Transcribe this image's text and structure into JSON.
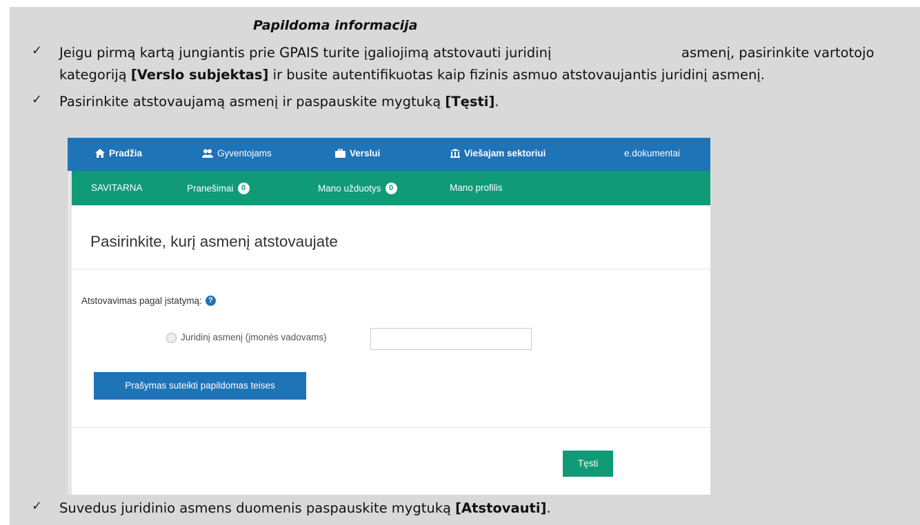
{
  "document": {
    "heading": "Papildoma informacija",
    "check_glyph": "✓",
    "bullet1": {
      "line1": "Jeigu pirmą kartą jungiantis prie GPAIS turite įgaliojimą atstovauti juridinį",
      "line1b": "asmenį, pasirinkite vartotojo",
      "line2_pre": "kategoriją ",
      "line2_bold": "[Verslo subjektas]",
      "line2_post": " ir busite autentifikuotas kaip fizinis asmuo atstovaujantis juridinį asmenį."
    },
    "bullet2": {
      "pre": "Pasirinkite atstovaujamą asmenį ir paspauskite mygtuką ",
      "bold": "[Tęsti]",
      "post": "."
    },
    "bullet3": {
      "pre": "Suvedus juridinio asmens duomenis paspauskite mygtuką ",
      "bold": "[Atstovauti]",
      "post": "."
    }
  },
  "screenshot": {
    "top_nav": {
      "home": "Pradžia",
      "residents": "Gyventojams",
      "business": "Verslui",
      "public_sector": "Viešajam sektoriui",
      "edocs": "e.dokumentai"
    },
    "sub_nav": {
      "self_service": "SAVITARNA",
      "messages": "Pranešimai",
      "messages_count": "0",
      "tasks": "Mano užduotys",
      "tasks_count": "0",
      "profile": "Mano profilis"
    },
    "page_title": "Pasirinkite, kurį asmenį atstovaujate",
    "legal_label": "Atstovavimas pagal įstatymą:",
    "help_glyph": "?",
    "radio_label": "Juridinį asmenį (įmonės vadovams)",
    "code_input_value": "",
    "request_button": "Prašymas suteikti papildomas teises",
    "continue_button": "Tęsti"
  }
}
